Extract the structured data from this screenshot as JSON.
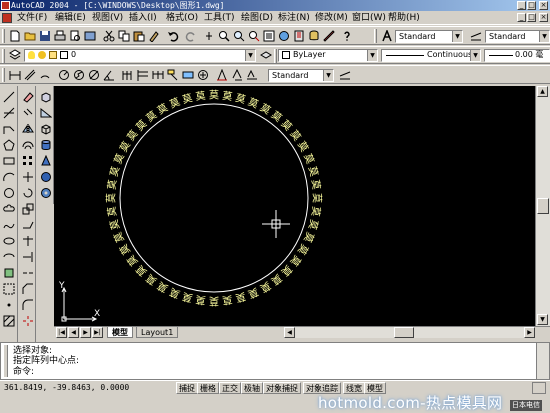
{
  "window": {
    "title": "AutoCAD 2004 - [C:\\WINDOWS\\Desktop\\图形1.dwg]",
    "controls": [
      "_",
      "□",
      "×"
    ]
  },
  "menubar": {
    "items": [
      "文件(F)",
      "编辑(E)",
      "视图(V)",
      "插入(I)",
      "格式(O)",
      "工具(T)",
      "绘图(D)",
      "标注(N)",
      "修改(M)",
      "窗口(W)",
      "帮助(H)"
    ]
  },
  "toolbar_standard": {
    "text_style": "Standard",
    "dim_style": "Standard",
    "arrow": "▼"
  },
  "toolbar_layers": {
    "layer_name": "0",
    "color": "ByLayer",
    "linetype": "Continuous",
    "lineweight": "0.00 毫"
  },
  "toolbar_dimension": {
    "dim_style": "Standard"
  },
  "drawing": {
    "ring_text": "莫",
    "ring_count": 48,
    "ucs_y": "Y",
    "ucs_x": "X",
    "ring_color": "#ffffa0",
    "circle_color": "#ffffff"
  },
  "tabs": {
    "arrows": [
      "|◀",
      "◀",
      "▶",
      "▶|"
    ],
    "items": [
      "模型",
      "Layout1"
    ]
  },
  "command": {
    "lines": [
      "选择对象:",
      "指定阵列中心点:",
      "命令:"
    ]
  },
  "status": {
    "coords": "361.8419, -39.8463, 0.0000",
    "toggles": [
      "捕捉",
      "栅格",
      "正交",
      "极轴",
      "对象捕捉",
      "对象追踪",
      "线宽",
      "模型"
    ]
  },
  "watermark": {
    "text": "hotmold.com-热点模具网",
    "corner": "日本电信"
  }
}
